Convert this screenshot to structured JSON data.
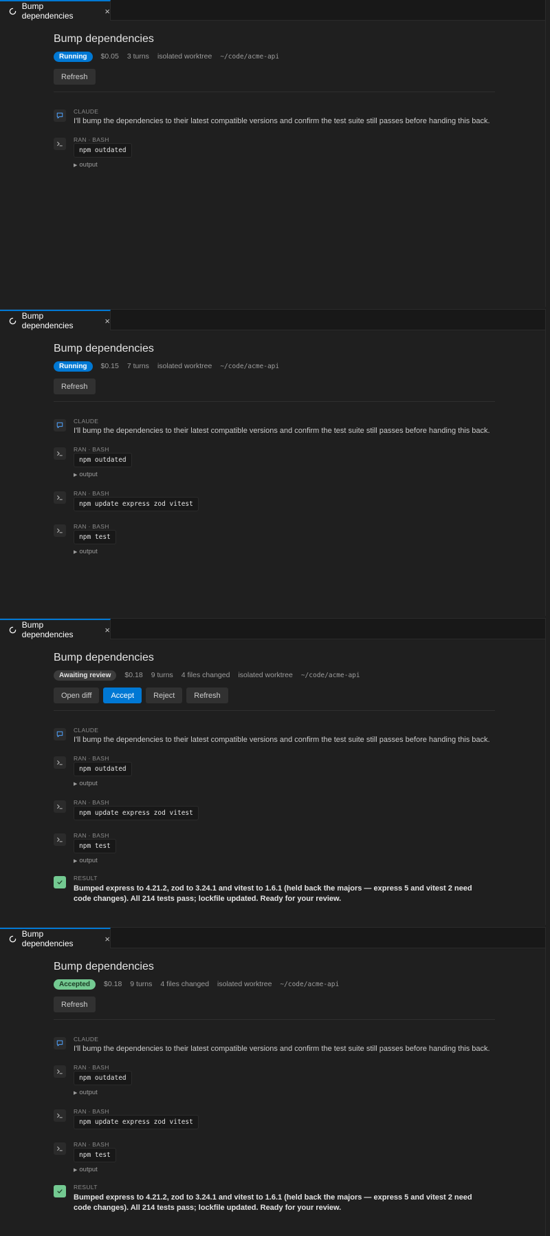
{
  "tab": {
    "title": "Bump dependencies",
    "close": "×"
  },
  "colors": {
    "accent": "#0078d4",
    "success": "#73c991",
    "background": "#1f1f1f"
  },
  "icons": {
    "tab": "loading-spinner-icon",
    "claude": "comment-icon",
    "bash": "terminal-prompt-icon",
    "result": "checkmark-icon"
  },
  "task": {
    "title": "Bump dependencies",
    "worktree": "isolated worktree",
    "path": "~/code/acme-api",
    "claude_label": "CLAUDE",
    "claude_message": "I'll bump the dependencies to their latest compatible versions and confirm the test suite still passes before handing this back.",
    "ran_label": "RAN · BASH",
    "output_label": "output",
    "result_label": "RESULT",
    "result_text": "Bumped express to 4.21.2, zod to 3.24.1 and vitest to 1.6.1 (held back the majors — express 5 and vitest 2 need code changes). All 214 tests pass; lockfile updated. Ready for your review.",
    "commands": [
      "npm outdated",
      "npm update express zod vitest",
      "npm test"
    ]
  },
  "panels": [
    {
      "status": "Running",
      "cost": "$0.05",
      "turns": "3 turns",
      "files": "",
      "buttons": [
        "Refresh"
      ]
    },
    {
      "status": "Running",
      "cost": "$0.15",
      "turns": "7 turns",
      "files": "",
      "buttons": [
        "Refresh"
      ]
    },
    {
      "status": "Awaiting review",
      "cost": "$0.18",
      "turns": "9 turns",
      "files": "4 files changed",
      "buttons": [
        "Open diff",
        "Accept",
        "Reject",
        "Refresh"
      ]
    },
    {
      "status": "Accepted",
      "cost": "$0.18",
      "turns": "9 turns",
      "files": "4 files changed",
      "buttons": [
        "Refresh"
      ]
    }
  ]
}
